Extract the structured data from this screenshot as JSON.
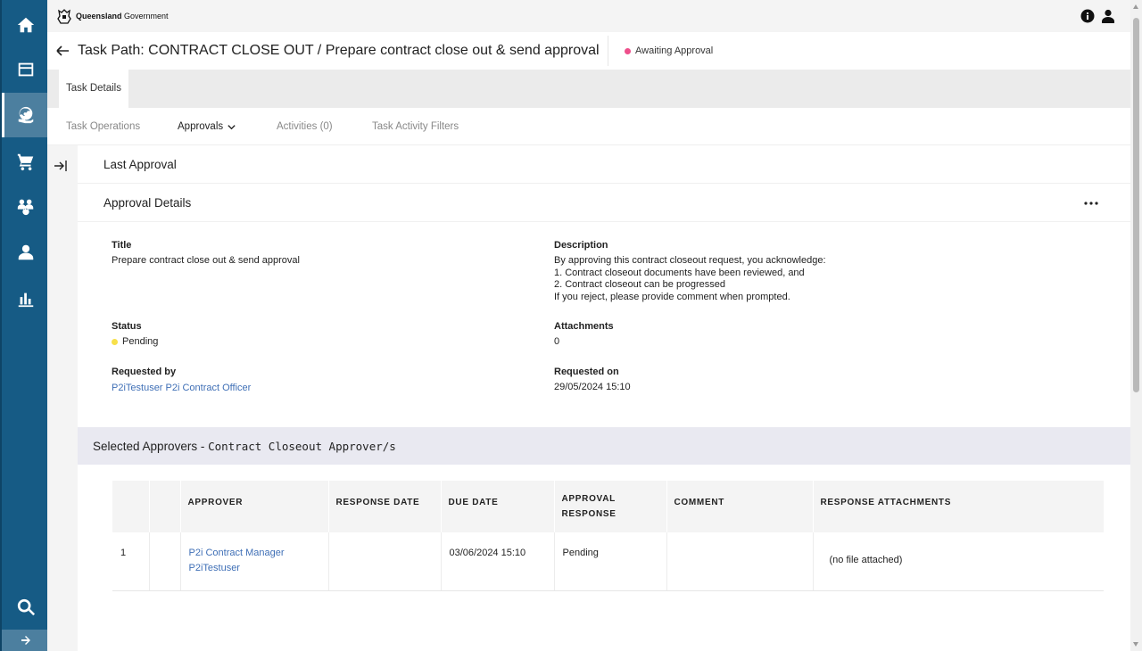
{
  "colors": {
    "sidebar": "#165b85",
    "sidebar_active": "#4c7f9f",
    "link": "#3f6fb6",
    "awaiting_dot": "#ee4f8b",
    "pending_dot": "#f7e04a"
  },
  "brand": {
    "bold": "Queensland",
    "rest": " Government"
  },
  "sidebar": {
    "items": [
      {
        "icon": "home-icon"
      },
      {
        "icon": "dashboard-icon"
      },
      {
        "icon": "globe-hand-icon",
        "active": true
      },
      {
        "icon": "cart-icon"
      },
      {
        "icon": "team-icon"
      },
      {
        "icon": "person-icon"
      },
      {
        "icon": "bar-chart-icon"
      },
      {
        "icon": "search-icon"
      }
    ],
    "expand_icon": "arrow-right-icon"
  },
  "topbar": {
    "icons": [
      "info-icon",
      "user-icon"
    ]
  },
  "header": {
    "title": "Task Path: CONTRACT CLOSE OUT / Prepare contract close out & send approval",
    "status": "Awaiting Approval"
  },
  "tabs": {
    "main": "Task Details"
  },
  "subnav": {
    "items": [
      {
        "label": "Task Operations"
      },
      {
        "label": "Approvals",
        "active": true
      },
      {
        "label": "Activities (0)"
      },
      {
        "label": "Task Activity Filters"
      }
    ]
  },
  "sections": {
    "last_approval": "Last Approval",
    "approval_details": "Approval Details"
  },
  "details": {
    "title_label": "Title",
    "title_value": "Prepare contract close out & send approval",
    "description_label": "Description",
    "description_lines": [
      "By approving this contract closeout request, you acknowledge:",
      "1. Contract closeout documents have been reviewed, and",
      "2. Contract closeout can be progressed",
      "If you reject, please provide comment when prompted."
    ],
    "status_label": "Status",
    "status_value": "Pending",
    "attachments_label": "Attachments",
    "attachments_value": "0",
    "requested_by_label": "Requested by",
    "requested_by_value": "P2iTestuser P2i Contract Officer",
    "requested_on_label": "Requested on",
    "requested_on_value": "29/05/2024 15:10"
  },
  "approvers": {
    "heading_prefix": "Selected Approvers - ",
    "heading_group": "Contract Closeout Approver/s",
    "columns": [
      "",
      "",
      "APPROVER",
      "RESPONSE DATE",
      "DUE DATE",
      "APPROVAL RESPONSE",
      "COMMENT",
      "RESPONSE ATTACHMENTS"
    ],
    "rows": [
      {
        "index": "1",
        "approver_line1": "P2i Contract Manager",
        "approver_line2": "P2iTestuser",
        "response_date": "",
        "due_date": "03/06/2024 15:10",
        "approval_response": "Pending",
        "comment": "",
        "attachments": "(no file attached)"
      }
    ]
  }
}
